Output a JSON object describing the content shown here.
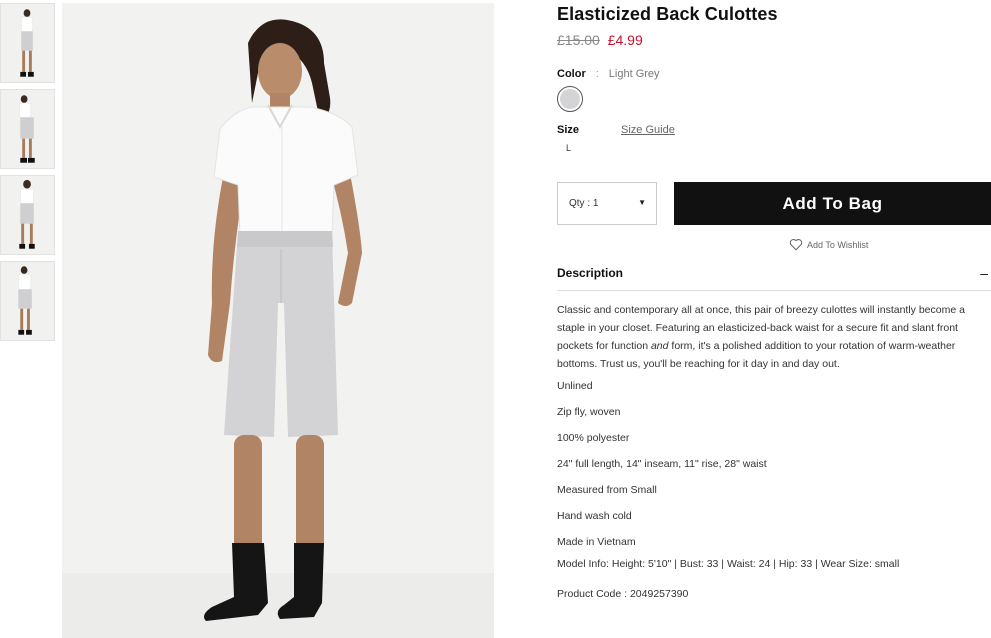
{
  "product": {
    "title": "Elasticized Back Culottes",
    "old_price": "£15.00",
    "sale_price": "£4.99",
    "color_label": "Color",
    "color_separator": ":",
    "color_value": "Light Grey",
    "swatch_color": "#d4d4d6",
    "size_label": "Size",
    "size_guide": "Size Guide",
    "size_option": "L",
    "qty_label": "Qty : 1",
    "add_to_bag": "Add To Bag",
    "wishlist": "Add To Wishlist",
    "description_heading": "Description",
    "description_toggle": "–",
    "description_pre": "Classic and contemporary all at once, this pair of breezy culottes will instantly become a staple in your closet. Featuring an elasticized-back waist for a secure fit and slant front pockets for function ",
    "description_em": "and",
    "description_post": " form, it's a polished addition to your rotation of warm-weather bottoms. Trust us, you'll be reaching for it day in and day out.",
    "features": [
      "Unlined",
      "Zip fly, woven",
      "100% polyester",
      "24\" full length, 14\" inseam, 11\" rise, 28\" waist",
      "Measured from Small",
      "Hand wash cold",
      "Made in Vietnam"
    ],
    "model_info": "Model Info: Height: 5'10\" | Bust: 33 | Waist: 24 | Hip: 33 | Wear Size: small",
    "product_code": "Product Code : 2049257390"
  },
  "colors": {
    "sale": "#c8102e",
    "button": "#111111"
  }
}
